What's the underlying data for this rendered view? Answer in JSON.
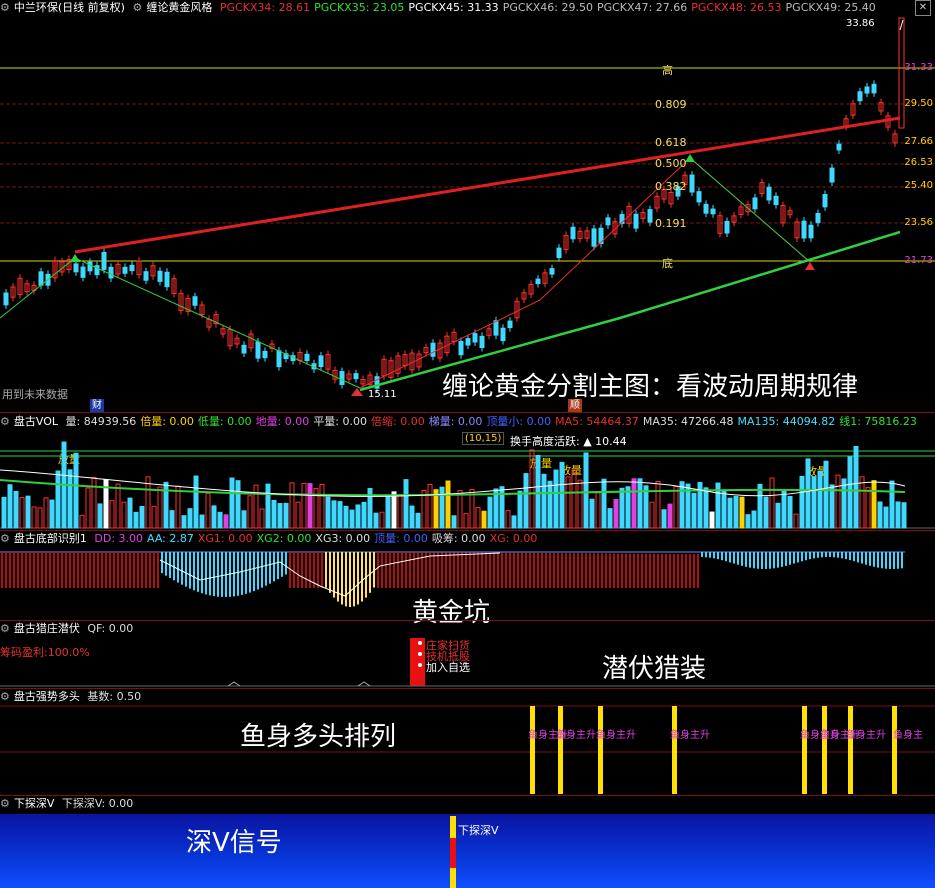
{
  "main_header": {
    "stock": "中兰环保(日线 前复权)",
    "indicator": "缠论黄金风格",
    "items": [
      {
        "label": "PGCKX34: 28.61",
        "color": "#e83030"
      },
      {
        "label": "PGCKX35: 23.05",
        "color": "#30e030"
      },
      {
        "label": "PGCKX45: 31.33",
        "color": "#ffffff"
      },
      {
        "label": "PGCKX46: 29.50",
        "color": "#bbbbbb"
      },
      {
        "label": "PGCKX47: 27.66",
        "color": "#bbbbbb"
      },
      {
        "label": "PGCKX48: 26.53",
        "color": "#e83030"
      },
      {
        "label": "PGCKX49: 25.40",
        "color": "#bbbbbb"
      }
    ]
  },
  "price_axis": [
    "31.33",
    "29.50",
    "27.66",
    "26.53",
    "25.40",
    "23.56",
    "21.73"
  ],
  "fib_labels": {
    "high": "高",
    "r0809": "0.809",
    "r0618": "0.618",
    "r0500": "0.500",
    "r0382": "0.382",
    "r0191": "0.191",
    "low": "底"
  },
  "price_marks": {
    "top": "33.86",
    "bottom": "15.11"
  },
  "main_misc": {
    "future_data": "用到未来数据",
    "cai": "财",
    "shun": "顺"
  },
  "main_title": "缠论黄金分割主图：看波动周期规律",
  "vol_header": {
    "name": "盘古VOL",
    "items": [
      {
        "label": "量: 84939.56",
        "color": "#dddddd"
      },
      {
        "label": "倍量: 0.00",
        "color": "#ffd000"
      },
      {
        "label": "低量: 0.00",
        "color": "#30e030"
      },
      {
        "label": "地量: 0.00",
        "color": "#e040e0"
      },
      {
        "label": "平量: 0.00",
        "color": "#dddddd"
      },
      {
        "label": "倍缩: 0.00",
        "color": "#e83030"
      },
      {
        "label": "梯量: 0.00",
        "color": "#8888ff"
      },
      {
        "label": "顶量小: 0.00",
        "color": "#4060ff"
      },
      {
        "label": "MA5: 54464.37",
        "color": "#e83030"
      },
      {
        "label": "MA35: 47266.48",
        "color": "#dddddd"
      },
      {
        "label": "MA135: 44094.82",
        "color": "#40e0ff"
      },
      {
        "label": "线1: 75816.23",
        "color": "#30e030"
      }
    ],
    "hsl": "(10,15)",
    "turnover": "换手高度活跃: ▲ 10.44",
    "fang": "放量"
  },
  "bottom_header": {
    "name": "盘古底部识别1",
    "items": [
      {
        "label": "DD: 3.00",
        "color": "#e040e0"
      },
      {
        "label": "AA: 2.87",
        "color": "#40e0ff"
      },
      {
        "label": "XG1: 0.00",
        "color": "#e83030"
      },
      {
        "label": "XG2: 0.00",
        "color": "#30e030"
      },
      {
        "label": "XG3: 0.00",
        "color": "#dddddd"
      },
      {
        "label": "顶量: 0.00",
        "color": "#4060ff"
      },
      {
        "label": "吸筹: 0.00",
        "color": "#dddddd"
      },
      {
        "label": "XG: 0.00",
        "color": "#e83030"
      }
    ],
    "title": "黄金坑"
  },
  "hunt_header": {
    "name": "盘古猎庄潜伏",
    "items": [
      {
        "label": "QF: 0.00",
        "color": "#dddddd"
      }
    ],
    "profit": "筹码盈利:100.0%",
    "signals": [
      "庄家扫货",
      "技机抵股",
      "加入自选"
    ],
    "title": "潜伏猎装"
  },
  "trend_header": {
    "name": "盘古强势多头",
    "items": [
      {
        "label": "基数: 0.50",
        "color": "#dddddd"
      }
    ],
    "tags": [
      "鱼身主升",
      "鱼身主升",
      "鱼身主升",
      "鱼身主升",
      "鱼身主升",
      "鱼身主升",
      "鱼身主升",
      "鱼身主"
    ],
    "title": "鱼身多头排列"
  },
  "deepv_header": {
    "name": "下探深V",
    "items": [
      {
        "label": "下探深V: 0.00",
        "color": "#dddddd"
      }
    ],
    "signal": "下探深V",
    "title": "深V信号"
  }
}
